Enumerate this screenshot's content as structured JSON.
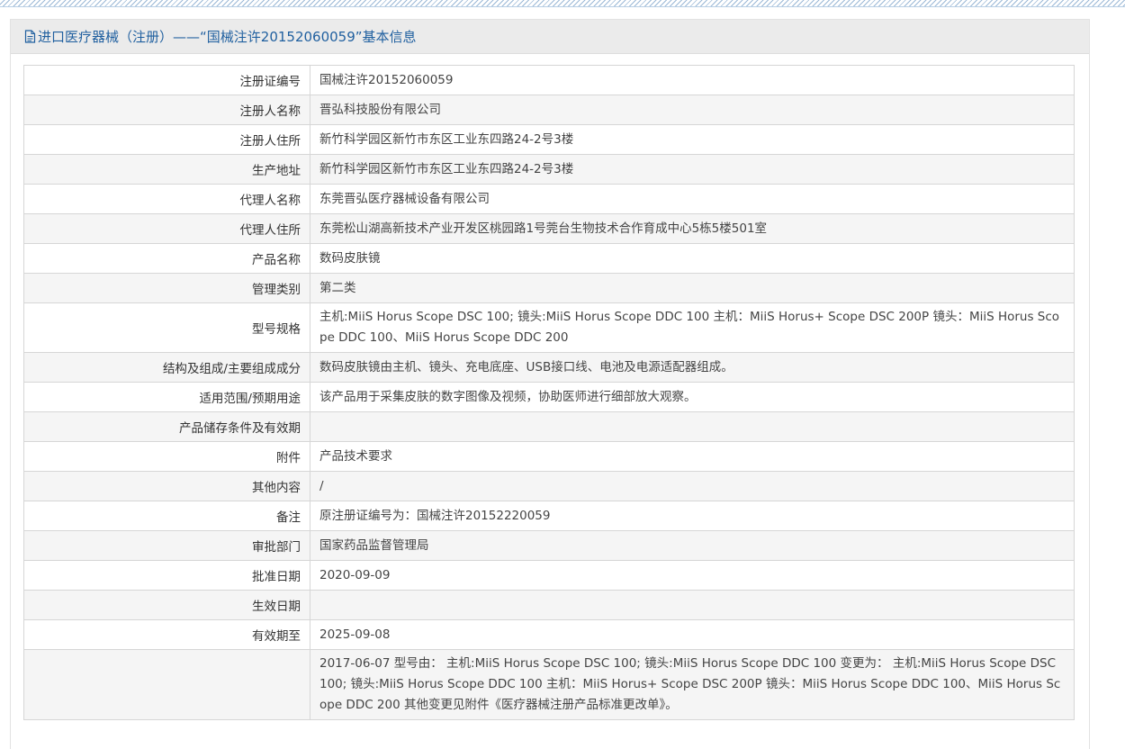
{
  "header": {
    "title": "进口医疗器械（注册）——“国械注许20152060059”基本信息",
    "icon": "document-icon"
  },
  "rows": [
    {
      "label": "注册证编号",
      "value": "国械注许20152060059"
    },
    {
      "label": "注册人名称",
      "value": "晋弘科技股份有限公司"
    },
    {
      "label": "注册人住所",
      "value": "新竹科学园区新竹市东区工业东四路24-2号3楼"
    },
    {
      "label": "生产地址",
      "value": "新竹科学园区新竹市东区工业东四路24-2号3楼"
    },
    {
      "label": "代理人名称",
      "value": "东莞晋弘医疗器械设备有限公司"
    },
    {
      "label": "代理人住所",
      "value": "东莞松山湖高新技术产业开发区桃园路1号莞台生物技术合作育成中心5栋5楼501室"
    },
    {
      "label": "产品名称",
      "value": "数码皮肤镜"
    },
    {
      "label": "管理类别",
      "value": "第二类"
    },
    {
      "label": "型号规格",
      "value": "主机:MiiS Horus Scope DSC 100; 镜头:MiiS Horus Scope DDC 100 主机：MiiS Horus+ Scope DSC 200P 镜头：MiiS Horus Scope DDC 100、MiiS Horus Scope DDC 200"
    },
    {
      "label": "结构及组成/主要组成成分",
      "value": "数码皮肤镜由主机、镜头、充电底座、USB接口线、电池及电源适配器组成。"
    },
    {
      "label": "适用范围/预期用途",
      "value": "该产品用于采集皮肤的数字图像及视频，协助医师进行细部放大观察。"
    },
    {
      "label": "产品储存条件及有效期",
      "value": ""
    },
    {
      "label": "附件",
      "value": "产品技术要求"
    },
    {
      "label": "其他内容",
      "value": "/"
    },
    {
      "label": "备注",
      "value": "原注册证编号为：国械注许20152220059"
    },
    {
      "label": "审批部门",
      "value": "国家药品监督管理局"
    },
    {
      "label": "批准日期",
      "value": "2020-09-09"
    },
    {
      "label": "生效日期",
      "value": ""
    },
    {
      "label": "有效期至",
      "value": "2025-09-08"
    },
    {
      "label": "",
      "value": "2017-06-07 型号由： 主机:MiiS Horus Scope DSC 100; 镜头:MiiS Horus Scope DDC 100 变更为： 主机:MiiS Horus Scope DSC 100; 镜头:MiiS Horus Scope DDC 100 主机：MiiS Horus+ Scope DSC 200P 镜头：MiiS Horus Scope DDC 100、MiiS Horus Scope DDC 200 其他变更见附件《医疗器械注册产品标准更改单》。"
    }
  ]
}
